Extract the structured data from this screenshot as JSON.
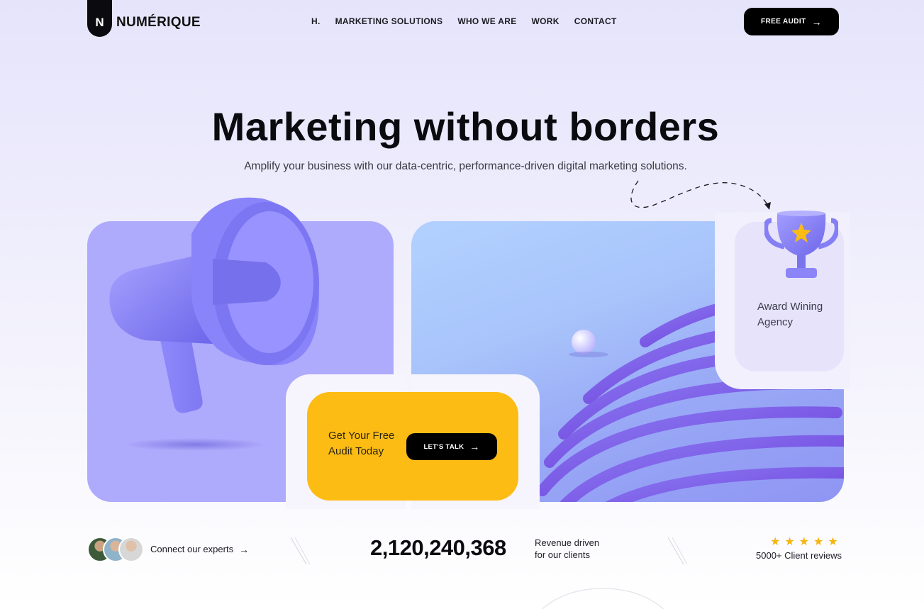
{
  "brand": {
    "mark": "N",
    "name": "NUMÉRIQUE"
  },
  "nav": {
    "items": [
      "H.",
      "MARKETING SOLUTIONS",
      "WHO WE ARE",
      "WORK",
      "CONTACT"
    ]
  },
  "header": {
    "cta_label": "FREE AUDIT"
  },
  "hero": {
    "title": "Marketing without borders",
    "subtitle": "Amplify your business with our data-centric, performance-driven digital marketing solutions."
  },
  "cards": {
    "yellow_text": "Get Your Free Audit Today",
    "talk_label": "LET'S TALK",
    "award_text": "Award Wining Agency"
  },
  "stats": {
    "connect_label": "Connect our experts",
    "revenue_number": "2,120,240,368",
    "revenue_label_line1": "Revenue driven",
    "revenue_label_line2": "for our clients",
    "rating_stars": 5,
    "reviews_label": "5000+ Client reviews"
  },
  "icons": {
    "arrow": "→",
    "star": "★"
  },
  "colors": {
    "accent_purple": "#aeaafc",
    "accent_yellow": "#fdbc14",
    "button_dark": "#000000",
    "star": "#f6b40d"
  }
}
